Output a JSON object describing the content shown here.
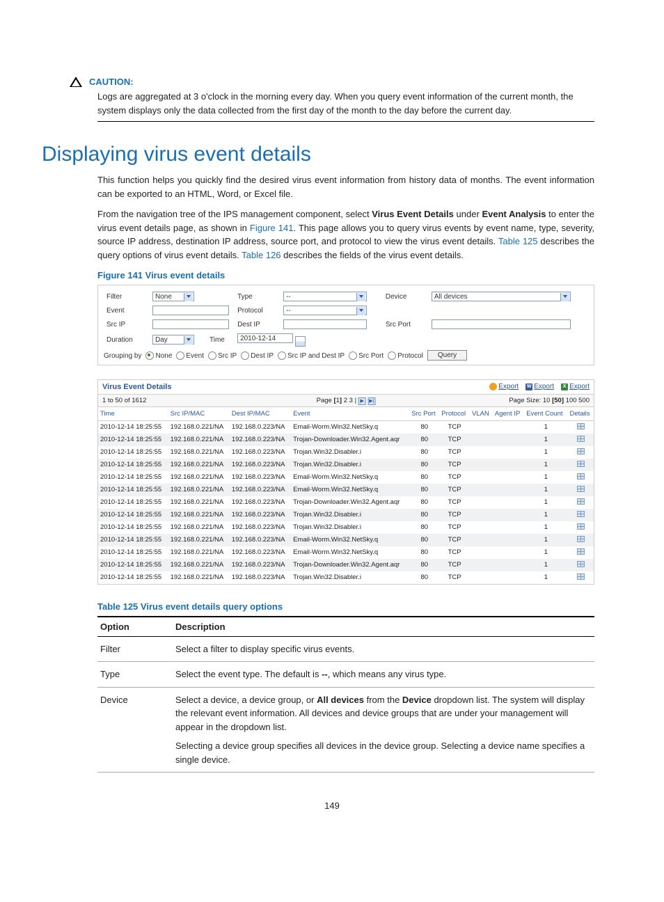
{
  "caution": {
    "label": "CAUTION:",
    "text": "Logs are aggregated at 3 o'clock in the morning every day. When you query event information of the current month, the system displays only the data collected from the first day of the month to the day before the current day."
  },
  "heading": "Displaying virus event details",
  "intro_p1": "This function helps you quickly find the desired virus event information from history data of months. The event information can be exported to an HTML, Word, or Excel file.",
  "intro_p2_a": "From the navigation tree of the IPS management component, select ",
  "intro_p2_bold1": "Virus Event Details",
  "intro_p2_b": " under ",
  "intro_p2_bold2": "Event Analysis",
  "intro_p2_c": " to enter the virus event details page, as shown in ",
  "intro_p2_link1": "Figure 141",
  "intro_p2_d": ". This page allows you to query virus events by event name, type, severity, source IP address, destination IP address, source port, and protocol to view the virus event details. ",
  "intro_p2_link2": "Table 125",
  "intro_p2_e": " describes the query options of virus event details. ",
  "intro_p2_link3": "Table 126",
  "intro_p2_f": " describes the fields of the virus event details.",
  "figure_caption": "Figure 141 Virus event details",
  "filter": {
    "labels": {
      "filter": "Filter",
      "type": "Type",
      "device": "Device",
      "event": "Event",
      "protocol": "Protocol",
      "srcip": "Src IP",
      "destip": "Dest IP",
      "srcport": "Src Port",
      "duration": "Duration",
      "time": "Time",
      "groupingby": "Grouping by"
    },
    "values": {
      "filter": "None",
      "type": "--",
      "device": "All devices",
      "protocol": "--",
      "duration": "Day",
      "time": "2010-12-14"
    },
    "grouping_options": [
      "None",
      "Event",
      "Src IP",
      "Dest IP",
      "Src IP and Dest IP",
      "Src Port",
      "Protocol"
    ],
    "query_btn": "Query"
  },
  "events_panel": {
    "title": "Virus Event Details",
    "exports": [
      "Export",
      "Export",
      "Export"
    ],
    "range": "1 to 50 of 1612",
    "page_label": "Page ",
    "pages": [
      "1",
      "2",
      "3"
    ],
    "page_size_label": "Page Size: 10 ",
    "page_size_current": "[50]",
    "page_size_rest": " 100 500",
    "columns": [
      "Time",
      "Src IP/MAC",
      "Dest IP/MAC",
      "Event",
      "Src Port",
      "Protocol",
      "VLAN",
      "Agent IP",
      "Event Count",
      "Details"
    ],
    "rows": [
      {
        "time": "2010-12-14 18:25:55",
        "src": "192.168.0.221/NA",
        "dst": "192.168.0.223/NA",
        "event": "Email-Worm.Win32.NetSky.q",
        "port": "80",
        "proto": "TCP",
        "vlan": "",
        "agent": "",
        "count": "1"
      },
      {
        "time": "2010-12-14 18:25:55",
        "src": "192.168.0.221/NA",
        "dst": "192.168.0.223/NA",
        "event": "Trojan-Downloader.Win32.Agent.aqr",
        "port": "80",
        "proto": "TCP",
        "vlan": "",
        "agent": "",
        "count": "1"
      },
      {
        "time": "2010-12-14 18:25:55",
        "src": "192.168.0.221/NA",
        "dst": "192.168.0.223/NA",
        "event": "Trojan.Win32.Disabler.i",
        "port": "80",
        "proto": "TCP",
        "vlan": "",
        "agent": "",
        "count": "1"
      },
      {
        "time": "2010-12-14 18:25:55",
        "src": "192.168.0.221/NA",
        "dst": "192.168.0.223/NA",
        "event": "Trojan.Win32.Disabler.i",
        "port": "80",
        "proto": "TCP",
        "vlan": "",
        "agent": "",
        "count": "1"
      },
      {
        "time": "2010-12-14 18:25:55",
        "src": "192.168.0.221/NA",
        "dst": "192.168.0.223/NA",
        "event": "Email-Worm.Win32.NetSky.q",
        "port": "80",
        "proto": "TCP",
        "vlan": "",
        "agent": "",
        "count": "1"
      },
      {
        "time": "2010-12-14 18:25:55",
        "src": "192.168.0.221/NA",
        "dst": "192.168.0.223/NA",
        "event": "Email-Worm.Win32.NetSky.q",
        "port": "80",
        "proto": "TCP",
        "vlan": "",
        "agent": "",
        "count": "1"
      },
      {
        "time": "2010-12-14 18:25:55",
        "src": "192.168.0.221/NA",
        "dst": "192.168.0.223/NA",
        "event": "Trojan-Downloader.Win32.Agent.aqr",
        "port": "80",
        "proto": "TCP",
        "vlan": "",
        "agent": "",
        "count": "1"
      },
      {
        "time": "2010-12-14 18:25:55",
        "src": "192.168.0.221/NA",
        "dst": "192.168.0.223/NA",
        "event": "Trojan.Win32.Disabler.i",
        "port": "80",
        "proto": "TCP",
        "vlan": "",
        "agent": "",
        "count": "1"
      },
      {
        "time": "2010-12-14 18:25:55",
        "src": "192.168.0.221/NA",
        "dst": "192.168.0.223/NA",
        "event": "Trojan.Win32.Disabler.i",
        "port": "80",
        "proto": "TCP",
        "vlan": "",
        "agent": "",
        "count": "1"
      },
      {
        "time": "2010-12-14 18:25:55",
        "src": "192.168.0.221/NA",
        "dst": "192.168.0.223/NA",
        "event": "Email-Worm.Win32.NetSky.q",
        "port": "80",
        "proto": "TCP",
        "vlan": "",
        "agent": "",
        "count": "1"
      },
      {
        "time": "2010-12-14 18:25:55",
        "src": "192.168.0.221/NA",
        "dst": "192.168.0.223/NA",
        "event": "Email-Worm.Win32.NetSky.q",
        "port": "80",
        "proto": "TCP",
        "vlan": "",
        "agent": "",
        "count": "1"
      },
      {
        "time": "2010-12-14 18:25:55",
        "src": "192.168.0.221/NA",
        "dst": "192.168.0.223/NA",
        "event": "Trojan-Downloader.Win32.Agent.aqr",
        "port": "80",
        "proto": "TCP",
        "vlan": "",
        "agent": "",
        "count": "1"
      },
      {
        "time": "2010-12-14 18:25:55",
        "src": "192.168.0.221/NA",
        "dst": "192.168.0.223/NA",
        "event": "Trojan.Win32.Disabler.i",
        "port": "80",
        "proto": "TCP",
        "vlan": "",
        "agent": "",
        "count": "1"
      }
    ]
  },
  "table_caption": "Table 125 Virus event details query options",
  "desc_table": {
    "head": [
      "Option",
      "Description"
    ],
    "rows": [
      {
        "option": "Filter",
        "desc": "Select a filter to display specific virus events."
      },
      {
        "option": "Type",
        "desc_a": "Select the event type. The default is ",
        "desc_bold": "--",
        "desc_b": ", which means any virus type."
      },
      {
        "option": "Device",
        "p1_a": "Select a device, a device group, or ",
        "p1_bold1": "All devices",
        "p1_b": " from the ",
        "p1_bold2": "Device",
        "p1_c": " dropdown list. The system will display the relevant event information. All devices and device groups that are under your management will appear in the dropdown list.",
        "p2": "Selecting a device group specifies all devices in the device group. Selecting a device name specifies a single device."
      }
    ]
  },
  "page_number": "149"
}
